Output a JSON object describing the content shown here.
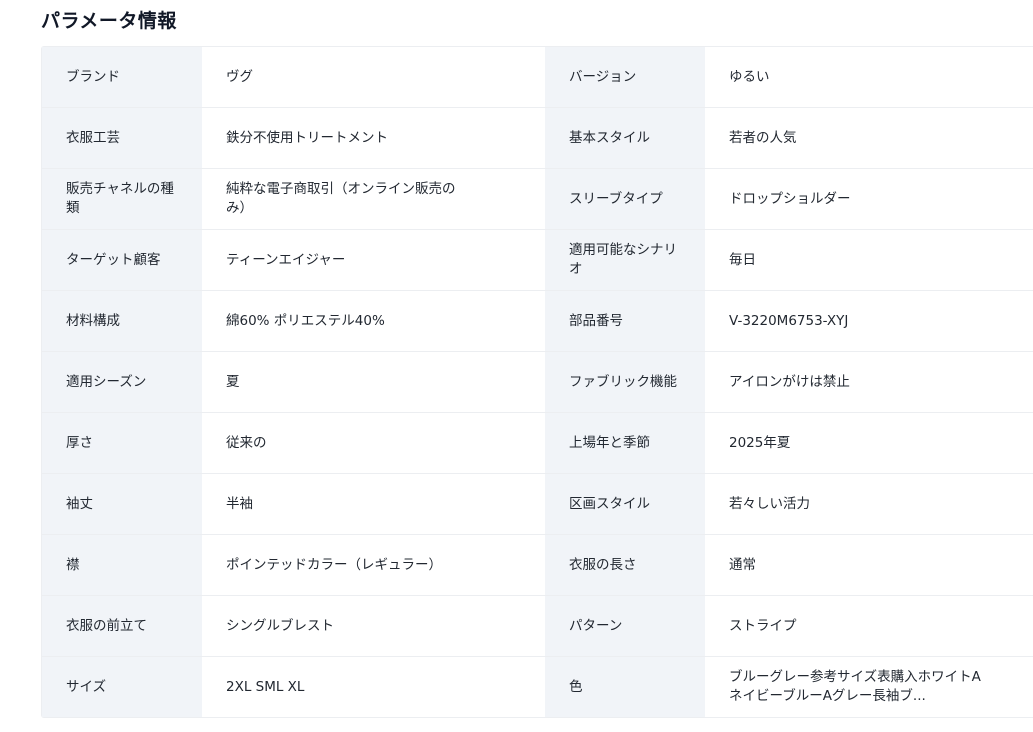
{
  "section": {
    "title": "パラメータ情報"
  },
  "params": [
    {
      "key1": "ブランド",
      "val1": "ヴグ",
      "key2": "バージョン",
      "val2": "ゆるい"
    },
    {
      "key1": "衣服工芸",
      "val1": "鉄分不使用トリートメント",
      "key2": "基本スタイル",
      "val2": "若者の人気"
    },
    {
      "key1": "販売チャネルの種類",
      "val1": "純粋な電子商取引（オンライン販売のみ）",
      "key2": "スリーブタイプ",
      "val2": "ドロップショルダー"
    },
    {
      "key1": "ターゲット顧客",
      "val1": "ティーンエイジャー",
      "key2": "適用可能なシナリオ",
      "val2": "毎日"
    },
    {
      "key1": "材料構成",
      "val1": "綿60% ポリエステル40%",
      "key2": "部品番号",
      "val2": "V-3220M6753-XYJ"
    },
    {
      "key1": "適用シーズン",
      "val1": "夏",
      "key2": "ファブリック機能",
      "val2": "アイロンがけは禁止"
    },
    {
      "key1": "厚さ",
      "val1": "従来の",
      "key2": "上場年と季節",
      "val2": "2025年夏"
    },
    {
      "key1": "袖丈",
      "val1": "半袖",
      "key2": "区画スタイル",
      "val2": "若々しい活力"
    },
    {
      "key1": "襟",
      "val1": "ポインテッドカラー（レギュラー）",
      "key2": "衣服の長さ",
      "val2": "通常"
    },
    {
      "key1": "衣服の前立て",
      "val1": "シングルブレスト",
      "key2": "パターン",
      "val2": "ストライプ"
    },
    {
      "key1": "サイズ",
      "val1": "2XL SML XL",
      "key2": "色",
      "val2": "ブルーグレー参考サイズ表購入ホワイトAネイビーブルーAグレー長袖ブ..."
    }
  ]
}
